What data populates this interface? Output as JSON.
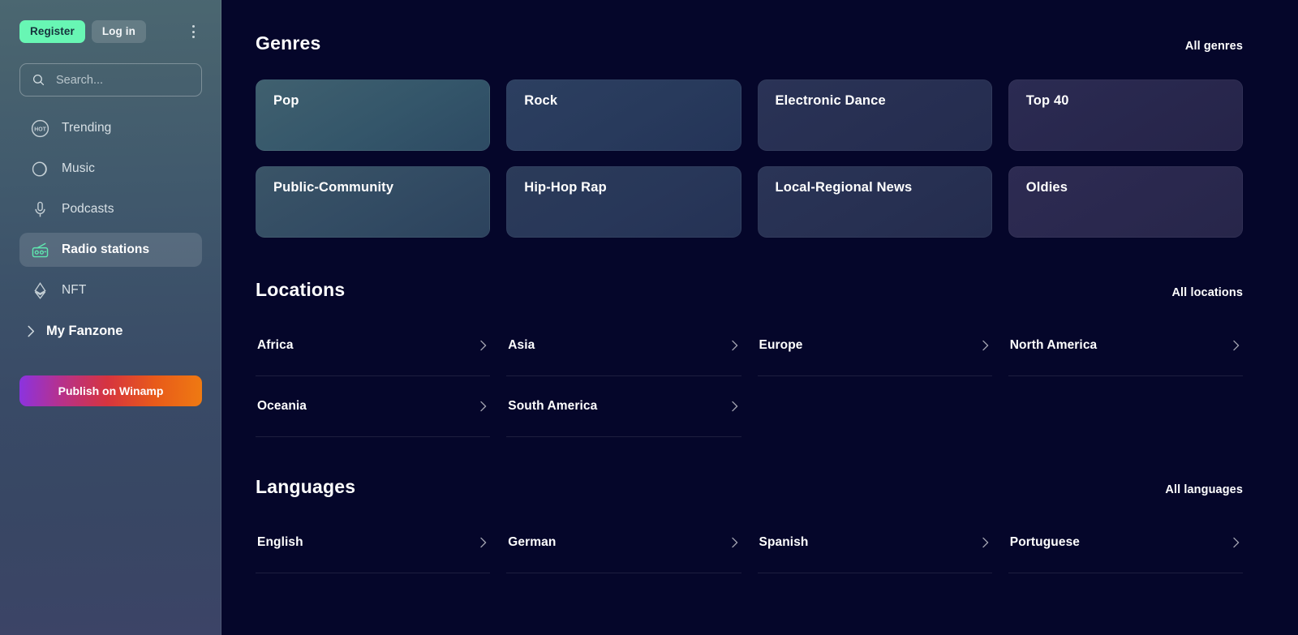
{
  "sidebar": {
    "auth": {
      "register_label": "Register",
      "login_label": "Log in"
    },
    "menu_icon": "kebab-menu-icon",
    "search": {
      "placeholder": "Search...",
      "value": "",
      "icon": "search-icon"
    },
    "nav": [
      {
        "label": "Trending",
        "icon": "hot-badge-icon",
        "active": false
      },
      {
        "label": "Music",
        "icon": "vinyl-disc-icon",
        "active": false
      },
      {
        "label": "Podcasts",
        "icon": "microphone-icon",
        "active": false
      },
      {
        "label": "Radio stations",
        "icon": "radio-icon",
        "active": true
      },
      {
        "label": "NFT",
        "icon": "ethereum-icon",
        "active": false
      }
    ],
    "fanzone_label": "My Fanzone",
    "publish_label": "Publish on Winamp"
  },
  "main": {
    "genres": {
      "title": "Genres",
      "all_label": "All genres",
      "items": [
        "Pop",
        "Rock",
        "Electronic Dance",
        "Top 40",
        "Public-Community",
        "Hip-Hop Rap",
        "Local-Regional News",
        "Oldies"
      ]
    },
    "locations": {
      "title": "Locations",
      "all_label": "All locations",
      "items": [
        "Africa",
        "Asia",
        "Europe",
        "North America",
        "Oceania",
        "South America"
      ]
    },
    "languages": {
      "title": "Languages",
      "all_label": "All languages",
      "items": [
        "English",
        "German",
        "Spanish",
        "Portuguese"
      ]
    }
  },
  "colors": {
    "accent_mint": "#68f6b4",
    "sidebar_top": "#4b6771",
    "sidebar_bottom": "#3c4467",
    "main_dark": "#05062a",
    "publish_gradient_start": "#8b33e0",
    "publish_gradient_end": "#ef7a12"
  }
}
